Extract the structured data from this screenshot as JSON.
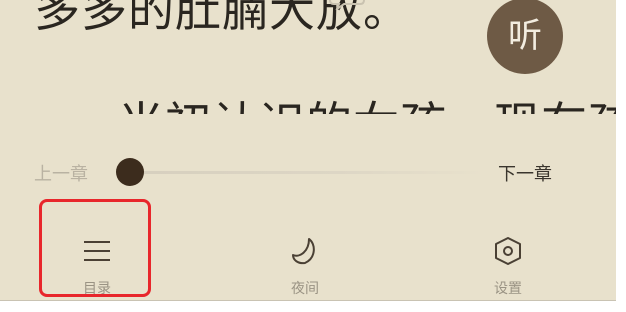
{
  "reader": {
    "line1": "多多的肚腩大放。",
    "line2": "当初认识的女孩，现在孩"
  },
  "listen_button": {
    "label": "听"
  },
  "progress": {
    "prev_label": "上一章",
    "next_label": "下一章",
    "value": 0.02
  },
  "toolbar": {
    "catalog_label": "目录",
    "night_label": "夜间",
    "settings_label": "设置"
  },
  "colors": {
    "background": "#e8e1cc",
    "accent": "#6e5a45",
    "thumb": "#3c2c1d",
    "highlight": "#e8262b"
  },
  "icons": {
    "catalog": "menu-lines-icon",
    "night": "moon-icon",
    "settings": "hexagon-gear-icon",
    "comment": "speech-bubble-icon"
  }
}
